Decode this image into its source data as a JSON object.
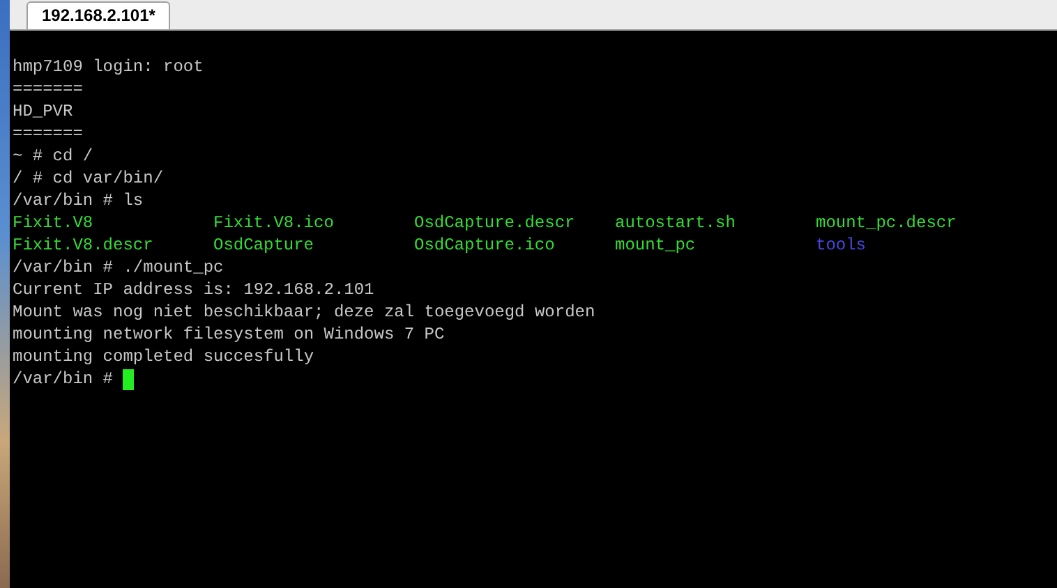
{
  "tabs": [
    {
      "label": "192.168.2.101*",
      "selected": true
    }
  ],
  "terminal": {
    "lines": [
      {
        "kind": "text",
        "text": "hmp7109 login: root"
      },
      {
        "kind": "text",
        "text": "======="
      },
      {
        "kind": "text",
        "text": "HD_PVR"
      },
      {
        "kind": "text",
        "text": "======="
      },
      {
        "kind": "text",
        "text": "~ # cd /"
      },
      {
        "kind": "text",
        "text": "/ # cd var/bin/"
      },
      {
        "kind": "text",
        "text": "/var/bin # ls"
      },
      {
        "kind": "listing",
        "entries": [
          {
            "text": "Fixit.V8",
            "color": "#33dd33"
          },
          {
            "text": "Fixit.V8.ico",
            "color": "#33dd33"
          },
          {
            "text": "OsdCapture.descr",
            "color": "#33dd33"
          },
          {
            "text": "autostart.sh",
            "color": "#33dd33"
          },
          {
            "text": "mount_pc.descr",
            "color": "#33dd33"
          }
        ]
      },
      {
        "kind": "listing",
        "entries": [
          {
            "text": "Fixit.V8.descr",
            "color": "#33dd33"
          },
          {
            "text": "OsdCapture",
            "color": "#33dd33"
          },
          {
            "text": "OsdCapture.ico",
            "color": "#33dd33"
          },
          {
            "text": "mount_pc",
            "color": "#33dd33"
          },
          {
            "text": "tools",
            "color": "#4646e0"
          }
        ]
      },
      {
        "kind": "text",
        "text": "/var/bin # ./mount_pc"
      },
      {
        "kind": "text",
        "text": "Current IP address is: 192.168.2.101"
      },
      {
        "kind": "text",
        "text": "Mount was nog niet beschikbaar; deze zal toegevoegd worden"
      },
      {
        "kind": "text",
        "text": "mounting network filesystem on Windows 7 PC"
      },
      {
        "kind": "text",
        "text": "mounting completed succesfully"
      },
      {
        "kind": "prompt",
        "text": "/var/bin #"
      }
    ],
    "cursor_visible": true
  }
}
